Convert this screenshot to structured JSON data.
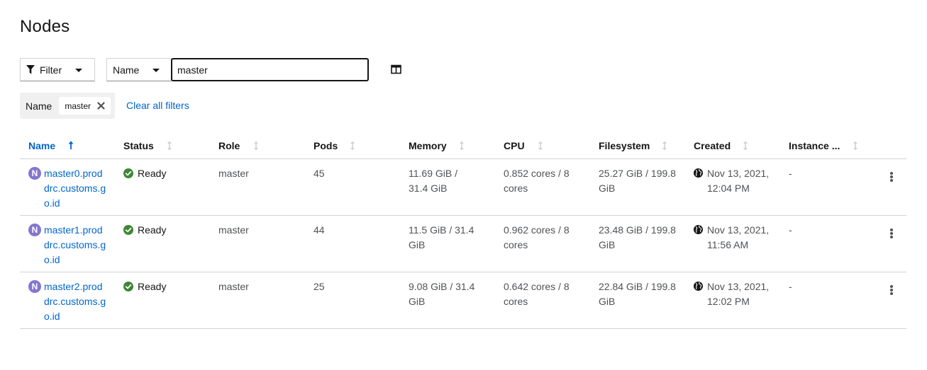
{
  "page": {
    "title": "Nodes"
  },
  "toolbar": {
    "filter_label": "Filter",
    "attribute_label": "Name",
    "search_value": "master"
  },
  "chips": {
    "category": "Name",
    "value": "master",
    "clear_label": "Clear all filters"
  },
  "table": {
    "columns": [
      "Name",
      "Status",
      "Role",
      "Pods",
      "Memory",
      "CPU",
      "Filesystem",
      "Created",
      "Instance ..."
    ],
    "sorted_column": "Name",
    "rows": [
      {
        "badge": "N",
        "name": "master0.proddrc.customs.go.id",
        "status": "Ready",
        "role": "master",
        "pods": "45",
        "memory": "11.69 GiB / 31.4 GiB",
        "cpu": "0.852 cores / 8 cores",
        "filesystem": "25.27 GiB / 199.8 GiB",
        "created_line1": "Nov 13, 2021,",
        "created_line2": "12:04 PM",
        "instance": "-"
      },
      {
        "badge": "N",
        "name": "master1.proddrc.customs.go.id",
        "status": "Ready",
        "role": "master",
        "pods": "44",
        "memory": "11.5 GiB / 31.4 GiB",
        "cpu": "0.962 cores / 8 cores",
        "filesystem": "23.48 GiB / 199.8 GiB",
        "created_line1": "Nov 13, 2021,",
        "created_line2": "11:56 AM",
        "instance": "-"
      },
      {
        "badge": "N",
        "name": "master2.proddrc.customs.go.id",
        "status": "Ready",
        "role": "master",
        "pods": "25",
        "memory": "9.08 GiB / 31.4 GiB",
        "cpu": "0.642 cores / 8 cores",
        "filesystem": "22.84 GiB / 199.8 GiB",
        "created_line1": "Nov 13, 2021,",
        "created_line2": "12:02 PM",
        "instance": "-"
      }
    ]
  },
  "icons": {
    "filter": "filter-icon",
    "columns": "columns-icon",
    "close": "close-icon",
    "status_ok": "check-circle-icon",
    "globe": "globe-icon",
    "kebab": "kebab-icon",
    "sort": "sort-icon"
  },
  "colors": {
    "link": "#0066cc",
    "ok": "#3e8635",
    "node_badge": "#8476d1",
    "border": "#d2d2d2"
  }
}
